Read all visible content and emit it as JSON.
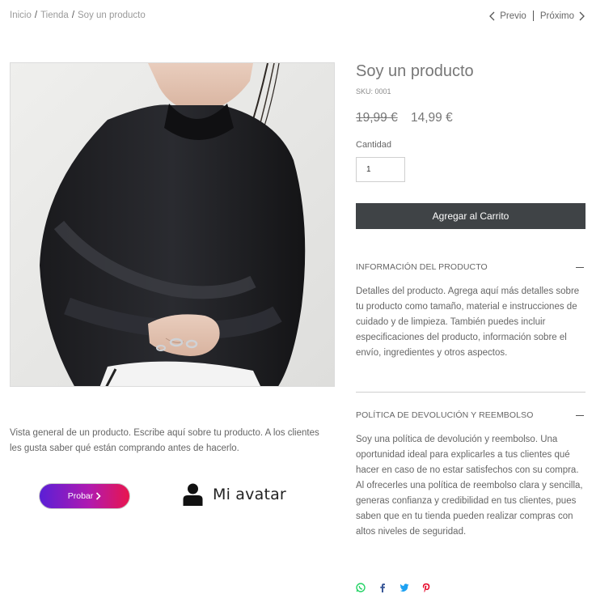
{
  "breadcrumb": {
    "home": "Inicio",
    "shop": "Tienda",
    "current": "Soy un producto",
    "separator": "/"
  },
  "pager": {
    "prev": "Previo",
    "next": "Próximo"
  },
  "product": {
    "title": "Soy un producto",
    "sku": "SKU: 0001",
    "price_old": "19,99 €",
    "price_new": "14,99 €",
    "quantity_label": "Cantidad",
    "quantity_value": "1",
    "add_to_cart": "Agregar al Carrito",
    "description": "Vista general de un producto. Escribe aquí sobre tu producto. A los clientes les gusta saber qué están comprando antes de hacerlo."
  },
  "sections": {
    "info": {
      "title": "INFORMACIÓN DEL PRODUCTO",
      "body": "Detalles del producto. Agrega aquí más detalles sobre tu producto como tamaño, material e instrucciones de cuidado y de limpieza. También puedes incluir especificaciones del producto, información sobre el envío, ingredientes y otros aspectos."
    },
    "refund": {
      "title": "POLÍTICA DE DEVOLUCIÓN Y REEMBOLSO",
      "body": "Soy una política de devolución y reembolso. Una oportunidad ideal para explicarles a tus clientes qué hacer en caso de no estar satisfechos con su compra. Al ofrecerles una política de reembolso clara y sencilla, generas confianza y credibilidad en tus clientes, pues saben que en tu tienda pueden realizar compras con altos niveles de seguridad."
    }
  },
  "widgets": {
    "try_button": "Probar",
    "avatar_label": "Mi avatar"
  },
  "colors": {
    "cart_button": "#3f4346",
    "try_gradient_start": "#5a1fd6",
    "try_gradient_end": "#e8154e",
    "whatsapp": "#25d366",
    "facebook": "#3b5998",
    "twitter": "#1da1f2",
    "pinterest": "#e60023"
  },
  "share_icons": [
    "whatsapp-icon",
    "facebook-icon",
    "twitter-icon",
    "pinterest-icon"
  ]
}
